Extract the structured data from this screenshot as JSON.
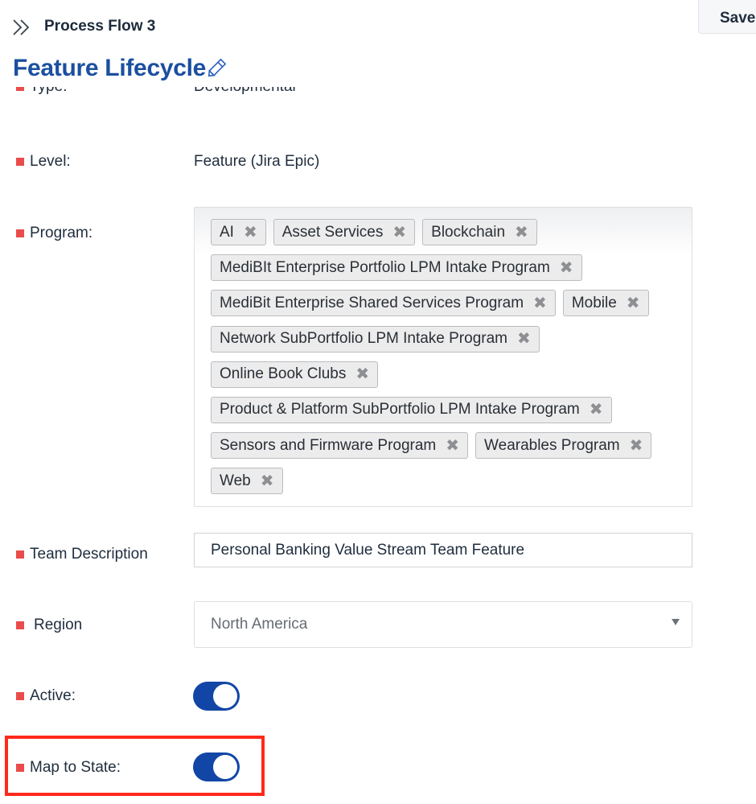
{
  "header": {
    "breadcrumb": "Process Flow 3",
    "save_label": "Save",
    "title": "Feature Lifecycle"
  },
  "fields": {
    "type": {
      "label": "Type:",
      "value": "Developmental"
    },
    "level": {
      "label": "Level:",
      "value": "Feature (Jira Epic)"
    },
    "program": {
      "label": "Program:",
      "tags": [
        "AI",
        "Asset Services",
        "Blockchain",
        "MediBIt Enterprise Portfolio LPM Intake Program",
        "MediBit Enterprise Shared Services Program",
        "Mobile",
        "Network SubPortfolio LPM Intake Program",
        "Online Book Clubs",
        "Product & Platform SubPortfolio LPM Intake Program",
        "Sensors and Firmware Program",
        "Wearables Program",
        "Web"
      ],
      "remove_glyph": "✖"
    },
    "team_description": {
      "label": "Team Description",
      "value": "Personal Banking Value Stream Team Feature"
    },
    "region": {
      "label": "Region",
      "value": "North America"
    },
    "active": {
      "label": "Active:",
      "on": true
    },
    "map_to_state": {
      "label": "Map to State:",
      "on": true
    }
  },
  "icons": {
    "breadcrumb": "double-chevron-right-icon",
    "edit": "pencil-icon",
    "dropdown": "caret-down-icon",
    "tag_remove": "x-icon"
  },
  "colors": {
    "title": "#1b4fa0",
    "required_marker": "#ea4b4b",
    "toggle_on": "#1246a6",
    "highlight": "#ff2a1a"
  }
}
